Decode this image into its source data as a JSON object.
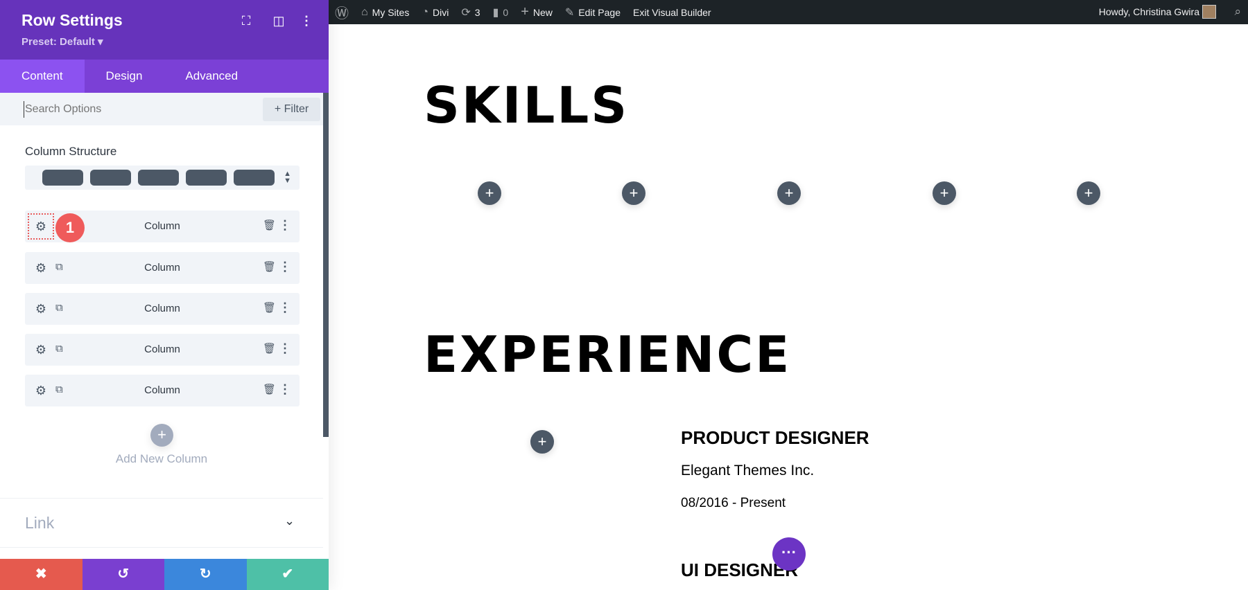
{
  "panel": {
    "title": "Row Settings",
    "preset": "Preset: Default ▾",
    "tabs": [
      "Content",
      "Design",
      "Advanced"
    ],
    "search_placeholder": "Search Options",
    "filter": "+ Filter",
    "column_structure_label": "Column Structure",
    "columns": [
      {
        "label": "Column"
      },
      {
        "label": "Column"
      },
      {
        "label": "Column"
      },
      {
        "label": "Column"
      },
      {
        "label": "Column"
      }
    ],
    "badge": "1",
    "add_column": "Add New Column",
    "link_section": "Link"
  },
  "wpbar": {
    "my_sites": "My Sites",
    "divi": "Divi",
    "updates": "3",
    "comments": "0",
    "new": "New",
    "edit_page": "Edit Page",
    "exit": "Exit Visual Builder",
    "howdy": "Howdy, Christina Gwira"
  },
  "page": {
    "skills": "SKILLS",
    "experience": "EXPERIENCE",
    "job1_title": "PRODUCT DESIGNER",
    "job1_company": "Elegant Themes Inc.",
    "job1_dates": "08/2016 - Present",
    "job2_title": "UI DESIGNER"
  },
  "colors": {
    "header": "#6633bb",
    "cancel": "#e55a4e",
    "undo": "#7a3fd0",
    "redo": "#3b87dc",
    "save": "#4ec0a7"
  }
}
